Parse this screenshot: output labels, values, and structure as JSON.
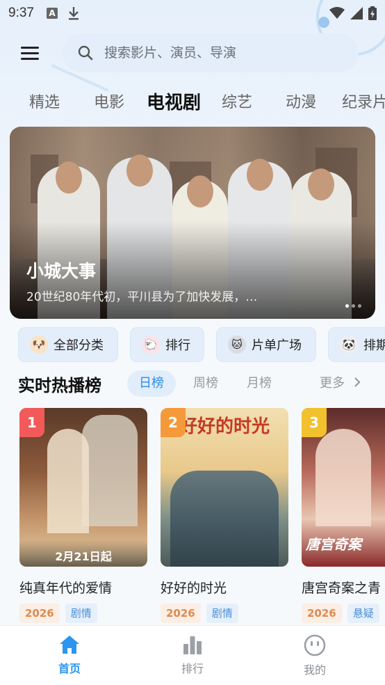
{
  "status_bar": {
    "time": "9:37",
    "a_icon": "A"
  },
  "search": {
    "placeholder": "搜索影片、演员、导演"
  },
  "category_tabs": [
    "精选",
    "电影",
    "电视剧",
    "综艺",
    "动漫",
    "纪录片"
  ],
  "active_category": "电视剧",
  "banner": {
    "title": "小城大事",
    "description": "20世纪80年代初，平川县为了加快发展，…"
  },
  "quick_chips": [
    {
      "label": "全部分类",
      "icon": "dog-emoji-icon"
    },
    {
      "label": "排行",
      "icon": "sheep-emoji-icon"
    },
    {
      "label": "片单广场",
      "icon": "cat-emoji-icon"
    },
    {
      "label": "排期",
      "icon": "panda-emoji-icon"
    }
  ],
  "hot_list": {
    "title": "实时热播榜",
    "periods": [
      "日榜",
      "周榜",
      "月榜"
    ],
    "active_period": "日榜",
    "more": "更多"
  },
  "cards": [
    {
      "rank": "1",
      "title": "纯真年代的爱情",
      "year": "2026",
      "genre": "剧情",
      "rank_color": "#f25a5a",
      "poster_text": "2月21日起"
    },
    {
      "rank": "2",
      "title": "好好的时光",
      "year": "2026",
      "genre": "剧情",
      "rank_color": "#f59a3a",
      "poster_text": "好好的时光"
    },
    {
      "rank": "3",
      "title": "唐宫奇案之青",
      "year": "2026",
      "genre": "悬疑",
      "rank_color": "#f2c12e",
      "poster_text": "唐宫奇案"
    }
  ],
  "bottom_nav": [
    {
      "label": "首页",
      "icon": "home-icon",
      "active": true
    },
    {
      "label": "排行",
      "icon": "bar-chart-icon",
      "active": false
    },
    {
      "label": "我的",
      "icon": "smile-face-icon",
      "active": false
    }
  ],
  "colors": {
    "accent": "#2b95ef",
    "search_bg": "#e3eefa"
  }
}
